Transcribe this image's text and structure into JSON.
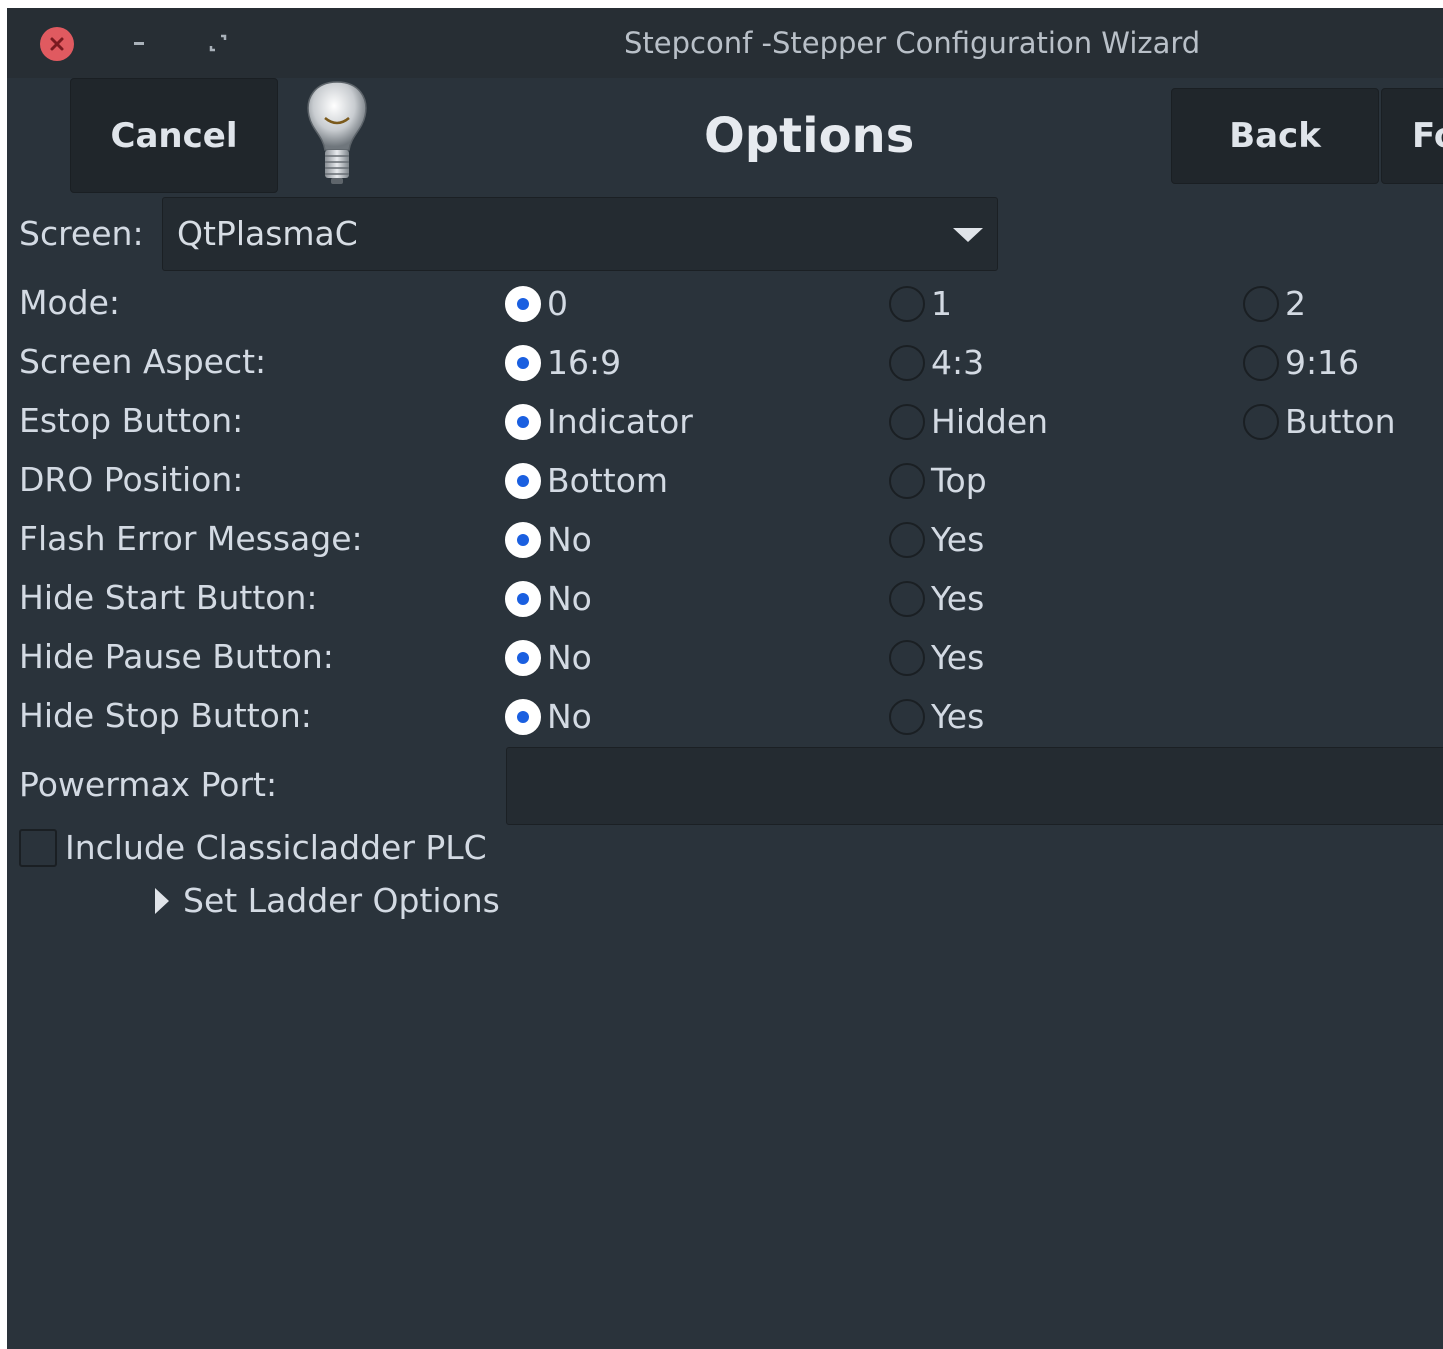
{
  "window": {
    "title": "Stepconf -Stepper Configuration Wizard"
  },
  "header": {
    "cancel_label": "Cancel",
    "page_title": "Options",
    "back_label": "Back",
    "forward_label_visible": "Fo"
  },
  "screen": {
    "label": "Screen:",
    "selected": "QtPlasmaC"
  },
  "options": [
    {
      "label": "Mode:",
      "choices": [
        "0",
        "1",
        "2"
      ],
      "selected": 0
    },
    {
      "label": "Screen Aspect:",
      "choices": [
        "16:9",
        "4:3",
        "9:16"
      ],
      "selected": 0
    },
    {
      "label": "Estop Button:",
      "choices": [
        "Indicator",
        "Hidden",
        "Button"
      ],
      "selected": 0
    },
    {
      "label": "DRO Position:",
      "choices": [
        "Bottom",
        "Top"
      ],
      "selected": 0
    },
    {
      "label": "Flash Error Message:",
      "choices": [
        "No",
        "Yes"
      ],
      "selected": 0
    },
    {
      "label": "Hide Start Button:",
      "choices": [
        "No",
        "Yes"
      ],
      "selected": 0
    },
    {
      "label": "Hide Pause Button:",
      "choices": [
        "No",
        "Yes"
      ],
      "selected": 0
    },
    {
      "label": "Hide Stop Button:",
      "choices": [
        "No",
        "Yes"
      ],
      "selected": 0
    }
  ],
  "powermax": {
    "label": "Powermax Port:",
    "value": ""
  },
  "classicladder": {
    "label": "Include Classicladder PLC",
    "checked": false
  },
  "ladder_expander": {
    "label": "Set Ladder Options",
    "expanded": false
  },
  "colors": {
    "background": "#2a333b",
    "titlebar": "#272e34",
    "button": "#20262b",
    "radio_accent": "#1a5fe0",
    "close_button": "#e05a60"
  }
}
